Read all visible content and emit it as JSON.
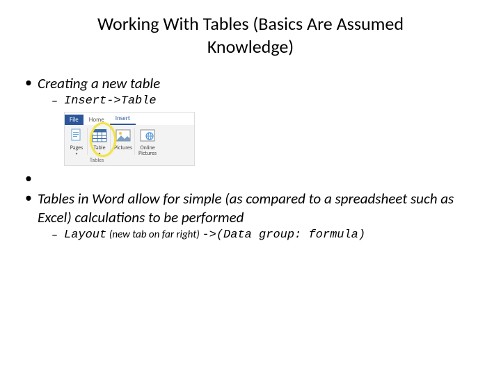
{
  "title": "Working With Tables (Basics Are Assumed Knowledge)",
  "bullets": {
    "b1": {
      "text": "Creating a new table",
      "sub1": "Insert->Table"
    },
    "b2": {
      "text": "Tables in Word allow for simple (as compared to a spreadsheet such as Excel) calculations to be performed",
      "sub1_a": "Layout",
      "sub1_b": "(new tab on far right)",
      "sub1_c": "->(Data group: formula)"
    }
  },
  "ribbon": {
    "tabs": {
      "file": "File",
      "home": "Home",
      "insert": "Insert"
    },
    "groups": {
      "pages": {
        "label": "Pages"
      },
      "table": {
        "label": "Table"
      },
      "pictures": {
        "label": "Pictures"
      },
      "online": {
        "label1": "Online",
        "label2": "Pictures"
      }
    },
    "footer": {
      "tables": "Tables"
    }
  }
}
